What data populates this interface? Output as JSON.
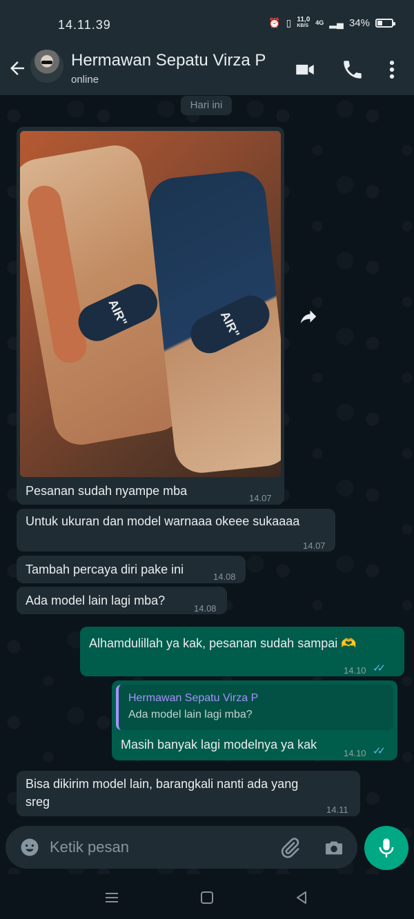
{
  "status_bar": {
    "time": "14.11.39",
    "speed_value": "11,0",
    "speed_unit": "KB/S",
    "network": "4G",
    "battery_percent": "34%",
    "battery_level": 0.34
  },
  "header": {
    "contact_name": "Hermawan Sepatu Virza P",
    "contact_status": "online",
    "icons": [
      "back-arrow-icon",
      "video-call-icon",
      "phone-call-icon",
      "more-options-icon"
    ]
  },
  "chat": {
    "date_chip": "Hari ini",
    "messages": [
      {
        "direction": "in",
        "type": "image",
        "caption": "Pesanan sudah nyampe mba",
        "time": "14.07"
      },
      {
        "direction": "in",
        "text": "Untuk ukuran dan model warnaaa okeee sukaaaa",
        "time": "14.07"
      },
      {
        "direction": "in",
        "text": "Tambah percaya diri pake ini",
        "time": "14.08"
      },
      {
        "direction": "in",
        "text": "Ada model lain lagi mba?",
        "time": "14.08"
      },
      {
        "direction": "out",
        "text": "Alhamdulillah ya kak, pesanan sudah sampai",
        "emoji": "🫶",
        "time": "14.10",
        "ticks": "✓✓"
      },
      {
        "direction": "out",
        "reply_to_name": "Hermawan Sepatu Virza P",
        "reply_to_text": "Ada model lain lagi mba?",
        "text": "Masih banyak lagi modelnya ya kak",
        "time": "14.10",
        "ticks": "✓✓"
      },
      {
        "direction": "in",
        "text_line1": "Bisa dikirim model lain, barangkali nanti ada yang",
        "text_line2": "sreg",
        "time": "14.11"
      }
    ],
    "photo_labels": {
      "air_left": "AIR\"",
      "air_right": "AIR\""
    }
  },
  "input": {
    "placeholder": "Ketik pesan"
  },
  "colors": {
    "header": "#1f2c34",
    "incoming_bubble": "#202c33",
    "outgoing_bubble": "#005c4b",
    "accent": "#00a884",
    "read_ticks": "#53bdeb"
  }
}
